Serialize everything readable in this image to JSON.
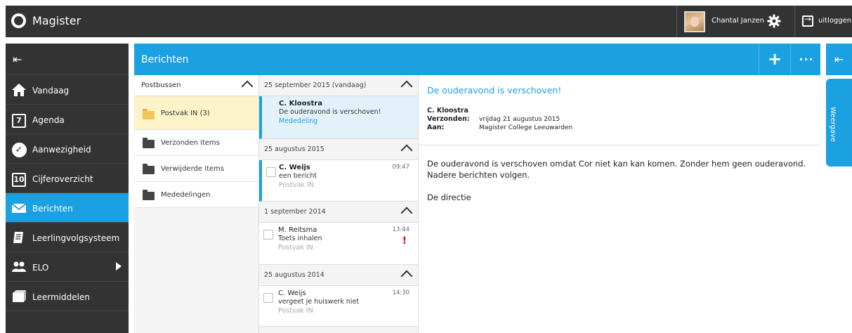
{
  "app": {
    "title": "Magister"
  },
  "user": {
    "name": "Chantal Janzen"
  },
  "logout": {
    "label": "uitloggen"
  },
  "sidebar": {
    "items": [
      {
        "label": "Vandaag",
        "icon": "home-icon"
      },
      {
        "label": "Agenda",
        "icon": "calendar-icon",
        "glyph": "7"
      },
      {
        "label": "Aanwezigheid",
        "icon": "check-circle-icon"
      },
      {
        "label": "Cijferoverzicht",
        "icon": "grades-icon",
        "glyph": "10"
      },
      {
        "label": "Berichten",
        "icon": "mail-icon",
        "active": true
      },
      {
        "label": "Leerlingvolgsysteem",
        "icon": "notebook-icon"
      },
      {
        "label": "ELO",
        "icon": "people-icon"
      },
      {
        "label": "Leermiddelen",
        "icon": "books-icon"
      }
    ]
  },
  "header": {
    "title": "Berichten",
    "add_label": "+",
    "more_label": "···"
  },
  "weergave": {
    "label": "Weergave"
  },
  "folders": {
    "header": "Postbussen",
    "items": [
      {
        "label": "Postvak IN (3)",
        "active": true
      },
      {
        "label": "Verzonden items"
      },
      {
        "label": "Verwijderde items"
      },
      {
        "label": "Mededelingen"
      }
    ]
  },
  "messages": {
    "groups": [
      {
        "date": "25 september 2015 (vandaag)",
        "items": [
          {
            "sender": "C. Kloostra",
            "subject": "De ouderavond is verschoven!",
            "folder": "Mededeling",
            "time": ""
          }
        ]
      },
      {
        "date": "25 augustus 2015",
        "items": [
          {
            "sender": "C. Weijs",
            "subject": "een bericht",
            "folder": "Postvak IN",
            "time": "09:47"
          }
        ]
      },
      {
        "date": "1 september 2014",
        "items": [
          {
            "sender": "M. Reitsma",
            "subject": "Toets inhalen",
            "folder": "Postvak IN",
            "time": "13:44",
            "flag": "!"
          }
        ]
      },
      {
        "date": "25 augustus 2014",
        "items": [
          {
            "sender": "C. Weijs",
            "subject": "vergeet je huiswerk niet",
            "folder": "Postvak IN",
            "time": "14:30"
          }
        ]
      }
    ]
  },
  "reader": {
    "subject": "De ouderavond is verschoven!",
    "sender": "C. Kloostra",
    "sent_label": "Verzonden:",
    "sent_value": "vrijdag 21 augustus 2015",
    "to_label": "Aan:",
    "to_value": "Magister College Leeuwarden",
    "body_line1": "De ouderavond is verschoven omdat Cor niet kan kan komen. Zonder hem geen ouderavond.",
    "body_line2": "Nadere berichten volgen.",
    "body_line3": "De directie"
  },
  "colors": {
    "accent": "#1ba1e2",
    "dark": "#333333",
    "folder_active": "#fdf3c9"
  }
}
